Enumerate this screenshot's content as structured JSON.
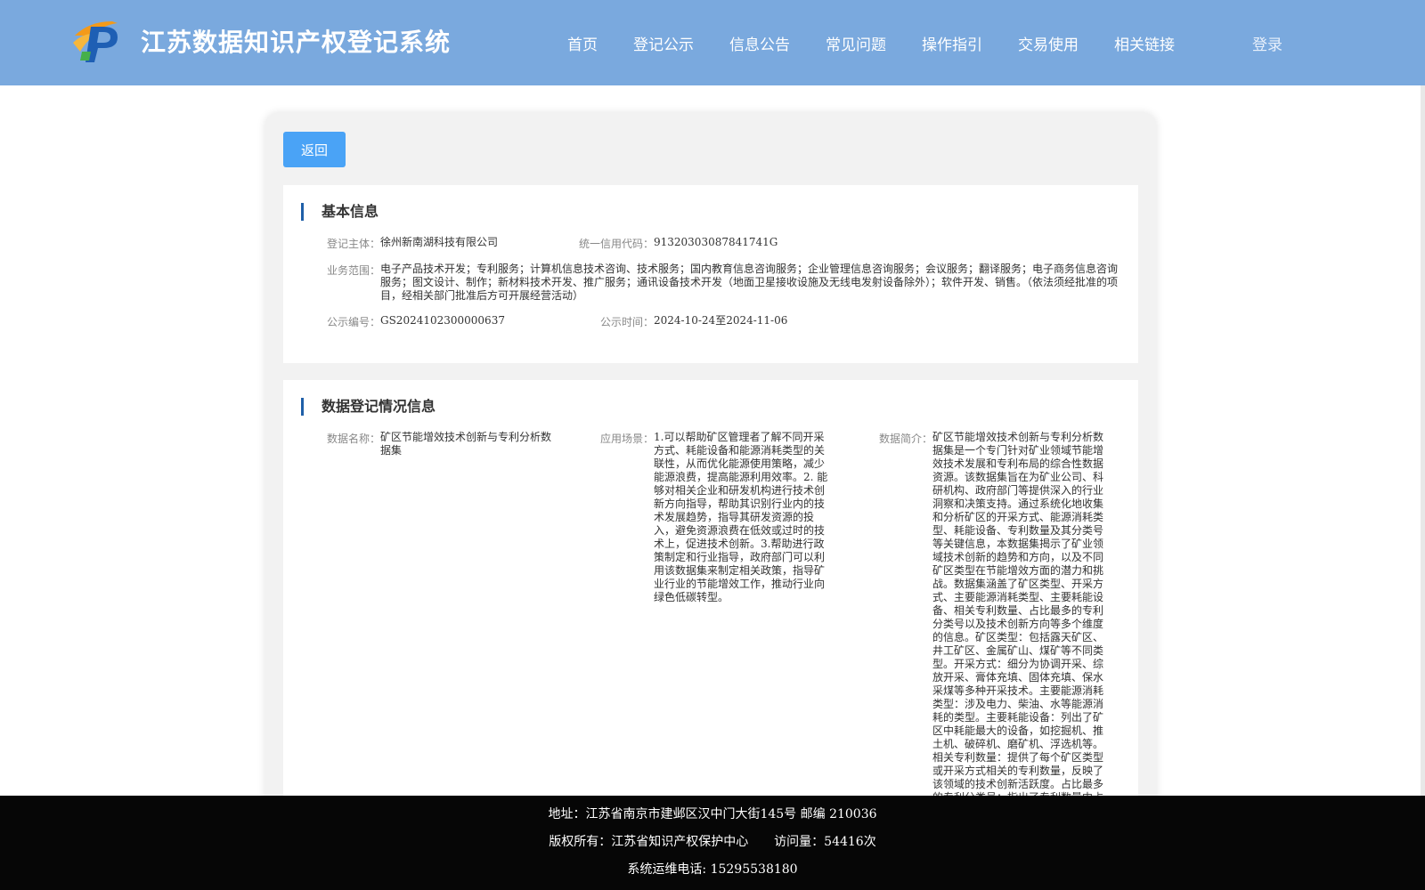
{
  "header": {
    "site_title": "江苏数据知识产权登记系统",
    "nav": [
      "首页",
      "登记公示",
      "信息公告",
      "常见问题",
      "操作指引",
      "交易使用",
      "相关链接"
    ],
    "login": "登录",
    "logo_icon": "jsip-logo-icon"
  },
  "main": {
    "back_label": "返回",
    "basic": {
      "heading": "基本信息",
      "subject_label": "登记主体：",
      "subject_value": "徐州新南湖科技有限公司",
      "credit_label": "统一信用代码：",
      "credit_value": "91320303087841741G",
      "scope_label": "业务范围：",
      "scope_value": "电子产品技术开发；专利服务；计算机信息技术咨询、技术服务；国内教育信息咨询服务；企业管理信息咨询服务；会议服务；翻译服务；电子商务信息咨询服务；图文设计、制作；新材料技术开发、推广服务；通讯设备技术开发（地面卫星接收设施及无线电发射设备除外）；软件开发、销售。（依法须经批准的项目，经相关部门批准后方可开展经营活动）",
      "pubno_label": "公示编号：",
      "pubno_value": "GS2024102300000637",
      "pubtime_label": "公示时间：",
      "pubtime_value": "2024-10-24至2024-11-06"
    },
    "data": {
      "heading": "数据登记情况信息",
      "name_label": "数据名称：",
      "name_value": "矿区节能增效技术创新与专利分析数据集",
      "scene_label": "应用场景：",
      "scene_value": "1.可以帮助矿区管理者了解不同开采方式、耗能设备和能源消耗类型的关联性，从而优化能源使用策略，减少能源浪费，提高能源利用效率。2. 能够对相关企业和研发机构进行技术创新方向指导，帮助其识别行业内的技术发展趋势，指导其研发资源的投入，避免资源浪费在低效或过时的技术上，促进技术创新。3.帮助进行政策制定和行业指导，政府部门可以利用该数据集来制定相关政策，指导矿业行业的节能增效工作，推动行业向绿色低碳转型。",
      "intro_label": "数据简介：",
      "intro_value": "矿区节能增效技术创新与专利分析数据集是一个专门针对矿业领域节能增效技术发展和专利布局的综合性数据资源。该数据集旨在为矿业公司、科研机构、政府部门等提供深入的行业洞察和决策支持。通过系统化地收集和分析矿区的开采方式、能源消耗类型、耗能设备、专利数量及其分类号等关键信息，本数据集揭示了矿业领域技术创新的趋势和方向，以及不同矿区类型在节能增效方面的潜力和挑战。数据集涵盖了矿区类型、开采方式、主要能源消耗类型、主要耗能设备、相关专利数量、占比最多的专利分类号以及技术创新方向等多个维度的信息。矿区类型：包括露天矿区、井工矿区、金属矿山、煤矿等不同类型。开采方式：细分为协调开采、综放开采、膏体充填、固体充填、保水采煤等多种开采技术。主要能源消耗类型：涉及电力、柴油、水等能源消耗的类型。主要耗能设备：列出了矿区中耗能最大的设备，如挖掘机、推土机、破碎机、磨矿机、浮选机等。相关专利数量：提供了每个矿区类型或开采方式相关的专利数量，反映了该领域的技术创新活跃度。占比最多的专利分类号：指出了专利数量中占比最多的分类号，揭示了技术创新的主要方向。"
    }
  },
  "footer": {
    "address": "地址：江苏省南京市建邺区汉中门大街145号 邮编 210036",
    "copyright": "版权所有：江苏省知识产权保护中心",
    "visits": "访问量：54416次",
    "phone": "系统运维电话: 15295538180"
  },
  "colors": {
    "header_bg": "#7aa9de",
    "button": "#4aa3f6",
    "accent_bar": "#1f5fa8",
    "footer_bg": "#060606"
  }
}
